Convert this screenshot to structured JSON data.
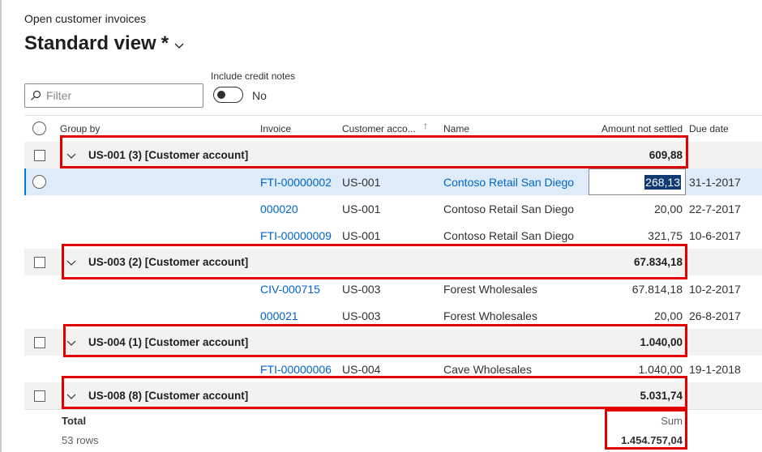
{
  "page": {
    "subtitle": "Open customer invoices",
    "view_title": "Standard view",
    "view_modified": "*"
  },
  "filter": {
    "placeholder": "Filter"
  },
  "credit_notes": {
    "label": "Include credit notes",
    "value": "No"
  },
  "columns": {
    "group_by": "Group by",
    "invoice": "Invoice",
    "customer_account": "Customer acco...",
    "name": "Name",
    "amount": "Amount not settled",
    "due_date": "Due date"
  },
  "groups": [
    {
      "label": "US-001 (3) [Customer account]",
      "total": "609,88",
      "rows": [
        {
          "invoice": "FTI-00000002",
          "account": "US-001",
          "name": "Contoso Retail San Diego",
          "amount": "268,13",
          "due": "31-1-2017"
        },
        {
          "invoice": "000020",
          "account": "US-001",
          "name": "Contoso Retail San Diego",
          "amount": "20,00",
          "due": "22-7-2017"
        },
        {
          "invoice": "FTI-00000009",
          "account": "US-001",
          "name": "Contoso Retail San Diego",
          "amount": "321,75",
          "due": "10-6-2017"
        }
      ]
    },
    {
      "label": "US-003 (2) [Customer account]",
      "total": "67.834,18",
      "rows": [
        {
          "invoice": "CIV-000715",
          "account": "US-003",
          "name": "Forest Wholesales",
          "amount": "67.814,18",
          "due": "10-2-2017"
        },
        {
          "invoice": "000021",
          "account": "US-003",
          "name": "Forest Wholesales",
          "amount": "20,00",
          "due": "26-8-2017"
        }
      ]
    },
    {
      "label": "US-004 (1) [Customer account]",
      "total": "1.040,00",
      "rows": [
        {
          "invoice": "FTI-00000006",
          "account": "US-004",
          "name": "Cave Wholesales",
          "amount": "1.040,00",
          "due": "19-1-2018"
        }
      ]
    },
    {
      "label": "US-008 (8) [Customer account]",
      "total": "5.031,74",
      "rows": []
    }
  ],
  "footer": {
    "total_label": "Total",
    "rows_count": "53 rows",
    "sum_label": "Sum",
    "sum_value": "1.454.757,04"
  },
  "colors": {
    "link": "#0064c8",
    "highlight_box": "#e00000",
    "selected_row": "#deecf9",
    "group_row": "#f3f2f1"
  }
}
